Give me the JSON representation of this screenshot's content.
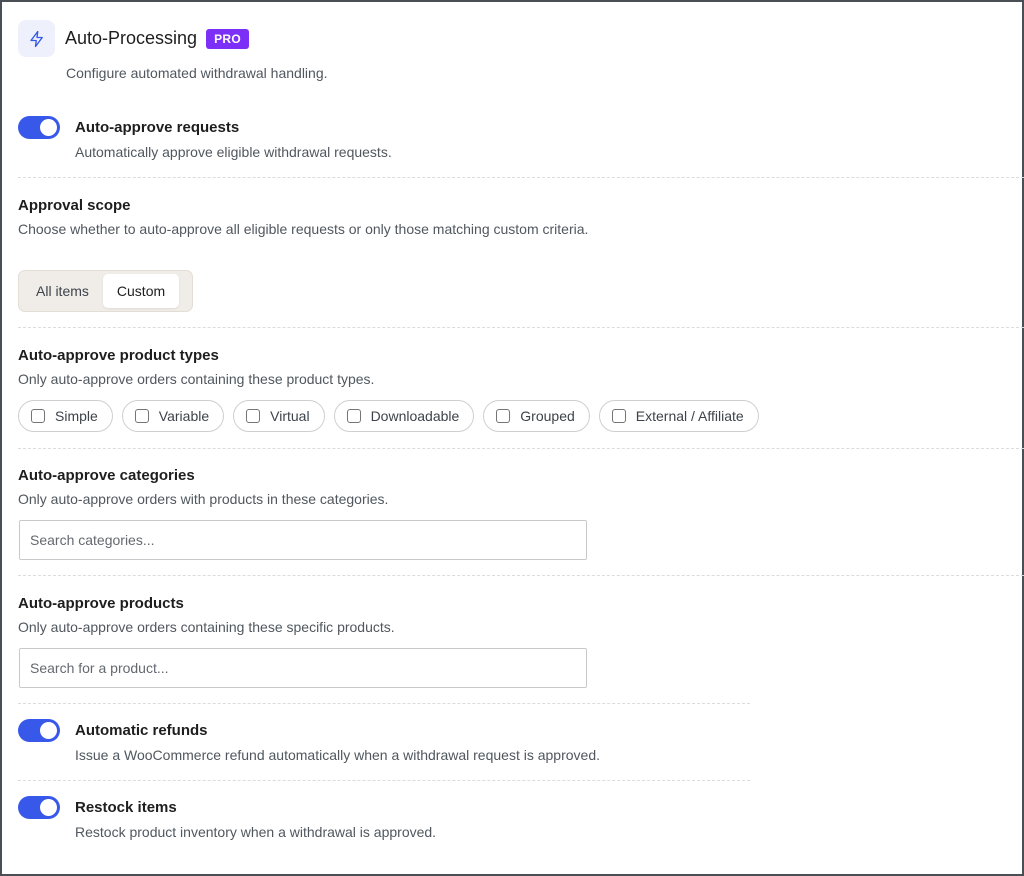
{
  "header": {
    "title": "Auto-Processing",
    "badge": "PRO",
    "description": "Configure automated withdrawal handling."
  },
  "auto_approve": {
    "label": "Auto-approve requests",
    "description": "Automatically approve eligible withdrawal requests.",
    "enabled": true
  },
  "approval_scope": {
    "label": "Approval scope",
    "description": "Choose whether to auto-approve all eligible requests or only those matching custom criteria.",
    "options": [
      "All items",
      "Custom"
    ],
    "selected": "Custom"
  },
  "product_types": {
    "label": "Auto-approve product types",
    "description": "Only auto-approve orders containing these product types.",
    "options": [
      "Simple",
      "Variable",
      "Virtual",
      "Downloadable",
      "Grouped",
      "External / Affiliate"
    ]
  },
  "categories": {
    "label": "Auto-approve categories",
    "description": "Only auto-approve orders with products in these categories.",
    "placeholder": "Search categories..."
  },
  "products": {
    "label": "Auto-approve products",
    "description": "Only auto-approve orders containing these specific products.",
    "placeholder": "Search for a product..."
  },
  "refunds": {
    "label": "Automatic refunds",
    "description": "Issue a WooCommerce refund automatically when a withdrawal request is approved.",
    "enabled": true
  },
  "restock": {
    "label": "Restock items",
    "description": "Restock product inventory when a withdrawal is approved.",
    "enabled": true
  },
  "colors": {
    "accent": "#3858e9",
    "pro_badge": "#7b2ff7"
  }
}
